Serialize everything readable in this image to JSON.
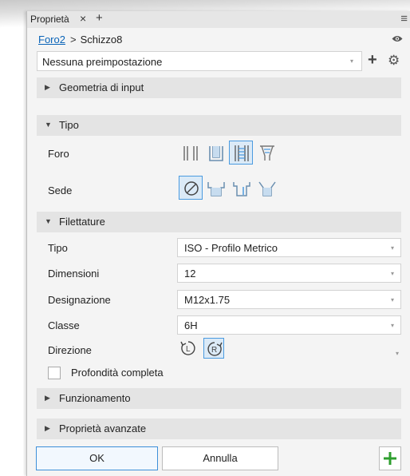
{
  "panel": {
    "tab_title": "Proprietà",
    "tab_close": "×",
    "tab_add": "+",
    "menu_icon": "hamburger-icon"
  },
  "breadcrumb": {
    "feature": "Foro2",
    "separator": ">",
    "sketch": "Schizzo8"
  },
  "preset": {
    "value": "Nessuna preimpostazione",
    "arrow": "▾",
    "add": "+",
    "gear": "⚙"
  },
  "sections": {
    "geometria": {
      "arrow": "▶",
      "label": "Geometria di input"
    },
    "tipo": {
      "arrow": "▼",
      "label": "Tipo"
    },
    "filettature": {
      "arrow": "▼",
      "label": "Filettature"
    },
    "funzionamento": {
      "arrow": "▶",
      "label": "Funzionamento"
    },
    "avanzate": {
      "arrow": "▶",
      "label": "Proprietà avanzate"
    }
  },
  "tipo": {
    "foro_label": "Foro",
    "sede_label": "Sede",
    "foro_options": [
      "simple-hole-icon",
      "clearance-hole-icon",
      "tapped-hole-icon",
      "taper-tapped-hole-icon"
    ],
    "foro_selected": 2,
    "sede_options": [
      "no-seat-icon",
      "counterbore-icon",
      "spotface-icon",
      "countersink-icon"
    ],
    "sede_selected": 0
  },
  "filettature": {
    "tipo_label": "Tipo",
    "tipo_value": "ISO - Profilo  Metrico",
    "dimensioni_label": "Dimensioni",
    "dimensioni_value": "12",
    "designazione_label": "Designazione",
    "designazione_value": "M12x1.75",
    "classe_label": "Classe",
    "classe_value": "6H",
    "direzione_label": "Direzione",
    "direzione_options": [
      "left-hand-thread-icon",
      "right-hand-thread-icon"
    ],
    "direzione_selected": 1,
    "profondita_label": "Profondità completa",
    "profondita_checked": false
  },
  "buttons": {
    "ok": "OK",
    "cancel": "Annulla",
    "apply_plus": "+"
  },
  "colors": {
    "accent": "#4b9be0",
    "link": "#0a64b8",
    "plus_green": "#2e9e2e"
  }
}
